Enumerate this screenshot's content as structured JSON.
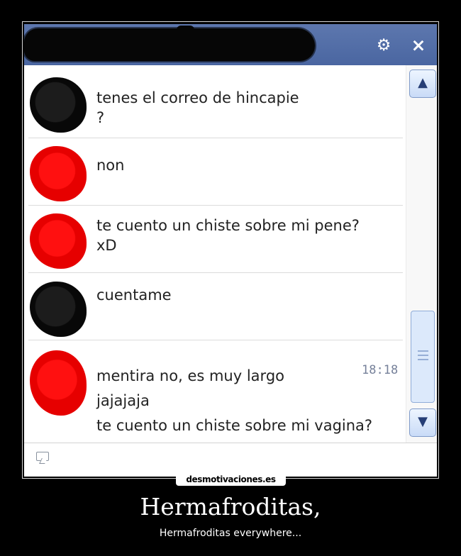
{
  "window": {
    "gear_icon": "⚙",
    "close_icon": "×"
  },
  "messages": [
    {
      "avatar_style": "black",
      "text": "tenes el correo de hincapie\n?"
    },
    {
      "avatar_style": "red",
      "text": "non"
    },
    {
      "avatar_style": "red",
      "text": "te cuento un chiste sobre mi pene?\nxD"
    },
    {
      "avatar_style": "black",
      "text": "cuentame"
    },
    {
      "avatar_style": "red",
      "text": "mentira no, es muy largo\njajajaja\nte cuento un chiste sobre mi vagina?"
    }
  ],
  "timestamp": "18:18",
  "scrollbar": {
    "up_icon": "▲",
    "down_icon": "▼"
  },
  "composer": {
    "icon": "emoticon-icon",
    "value": ""
  },
  "poster": {
    "watermark": "desmotivaciones.es",
    "title": "Hermafroditas,",
    "subtitle": "Hermafroditas everywhere..."
  }
}
